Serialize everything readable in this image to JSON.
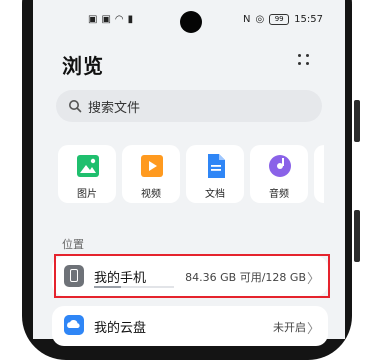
{
  "status_bar": {
    "time": "15:57",
    "battery": "99"
  },
  "header": {
    "title": "浏览"
  },
  "search": {
    "placeholder": "搜索文件"
  },
  "categories": [
    {
      "label": "图片",
      "icon": "picture-icon",
      "color": "#1fbf6e"
    },
    {
      "label": "视频",
      "icon": "video-icon",
      "color": "#ff9a1f"
    },
    {
      "label": "文档",
      "icon": "document-icon",
      "color": "#2f86f6"
    },
    {
      "label": "音频",
      "icon": "audio-icon",
      "color": "#8a62e8"
    }
  ],
  "locations": {
    "section_title": "位置",
    "items": [
      {
        "label": "我的手机",
        "value": "84.36 GB 可用/128 GB",
        "icon": "phone-icon",
        "used_fraction": 0.34
      },
      {
        "label": "我的云盘",
        "value": "未开启",
        "icon": "cloud-icon"
      }
    ]
  },
  "colors": {
    "highlight": "#e5232d",
    "background": "#f1f3f5"
  }
}
